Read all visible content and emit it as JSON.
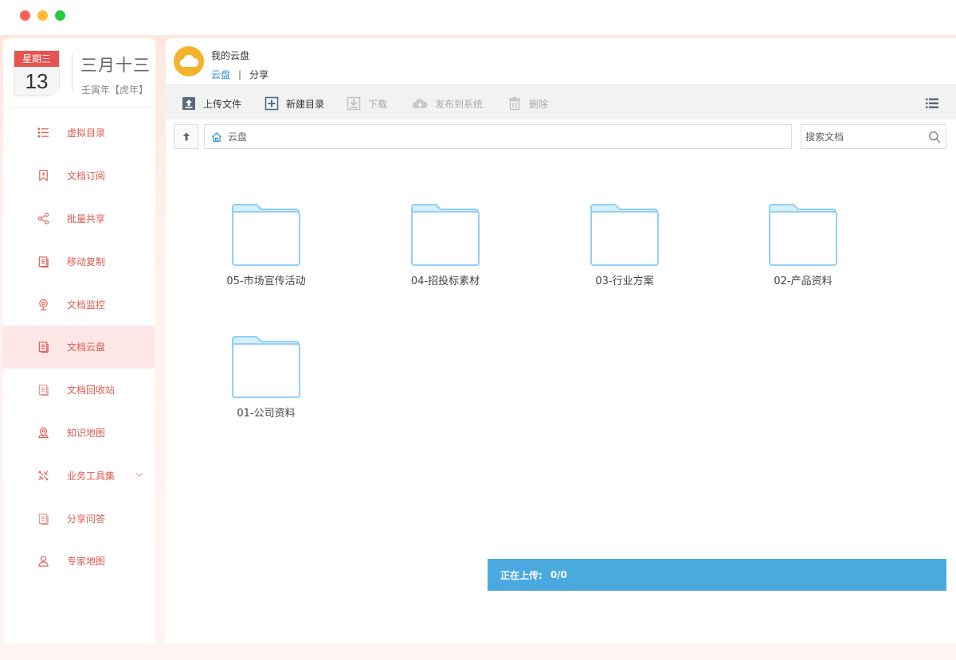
{
  "sidebar": {
    "calendar": {
      "weekday": "星期三",
      "day": "13",
      "lunar_date": "三月十三",
      "year_label": "壬寅年【虎年】"
    },
    "items": [
      {
        "label": "虚拟目录",
        "icon": "list-icon"
      },
      {
        "label": "文档订阅",
        "icon": "bookmark-icon"
      },
      {
        "label": "批量共享",
        "icon": "share-icon"
      },
      {
        "label": "移动复制",
        "icon": "document-icon"
      },
      {
        "label": "文档监控",
        "icon": "webcam-icon"
      },
      {
        "label": "文档云盘",
        "icon": "document-icon",
        "active": true
      },
      {
        "label": "文档回收站",
        "icon": "document-stack-icon"
      },
      {
        "label": "知识地图",
        "icon": "map-pin-icon"
      },
      {
        "label": "业务工具集",
        "icon": "tools-icon",
        "expandable": true
      },
      {
        "label": "分享问答",
        "icon": "document-stack-icon"
      },
      {
        "label": "专家地图",
        "icon": "user-icon"
      }
    ]
  },
  "header": {
    "title": "我的云盘",
    "tabs": {
      "cloud": "云盘",
      "separator": "|",
      "share": "分享"
    }
  },
  "toolbar": {
    "upload": "上传文件",
    "new_folder": "新建目录",
    "download": "下载",
    "publish": "发布到系统",
    "delete": "删除"
  },
  "path": {
    "current": "云盘"
  },
  "search": {
    "placeholder": "搜索文档"
  },
  "folders": [
    "05-市场宣传活动",
    "04-招投标素材",
    "03-行业方案",
    "02-产品资料",
    "01-公司资料"
  ],
  "upload_status": {
    "label": "正在上传:",
    "count": "0/0"
  },
  "colors": {
    "accent_red": "#e05a4f",
    "active_bg": "#fde7e6",
    "link_blue": "#2d8ce0",
    "upload_bar": "#4aa9df",
    "folder_stroke": "#8fd0f5",
    "cloud_logo": "#f3b32c"
  }
}
